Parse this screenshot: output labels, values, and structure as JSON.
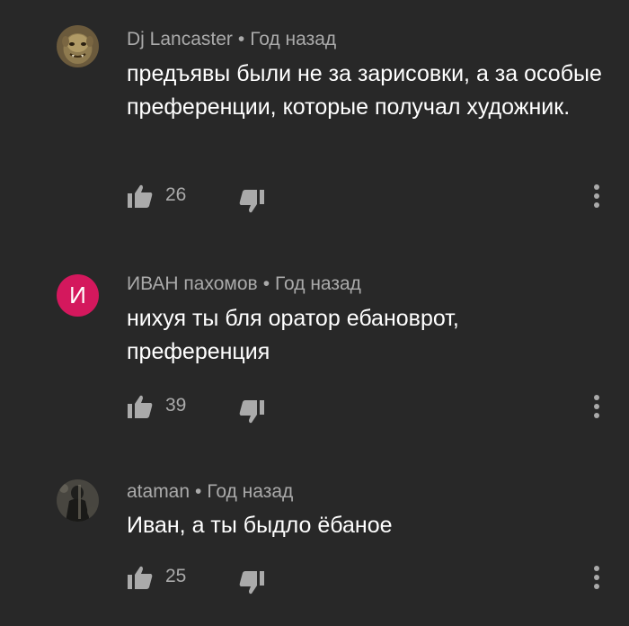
{
  "comments": [
    {
      "author": "Dj Lancaster",
      "separator": "•",
      "time": "Год назад",
      "text": "предъявы были не за зарисовки, а за особые преференции, которые получал художник.",
      "likes": "26",
      "avatar": "ogre-portrait"
    },
    {
      "author": "ИВАН пахомов",
      "separator": "•",
      "time": "Год назад",
      "text": "нихуя ты бля оратор ебановрот, преференция",
      "likes": "39",
      "avatar_letter": "И",
      "avatar_color": "#d4185d"
    },
    {
      "author": "ataman",
      "separator": "•",
      "time": "Год назад",
      "text": "Иван, а ты быдло ёбаное",
      "likes": "25",
      "avatar": "dark-figure-photo"
    }
  ],
  "icons": {
    "like": "thumb-up-icon",
    "dislike": "thumb-down-icon",
    "more": "more-vert-icon"
  },
  "colors": {
    "background": "#282828",
    "meta_text": "#aaaaaa",
    "body_text": "#ffffff"
  }
}
